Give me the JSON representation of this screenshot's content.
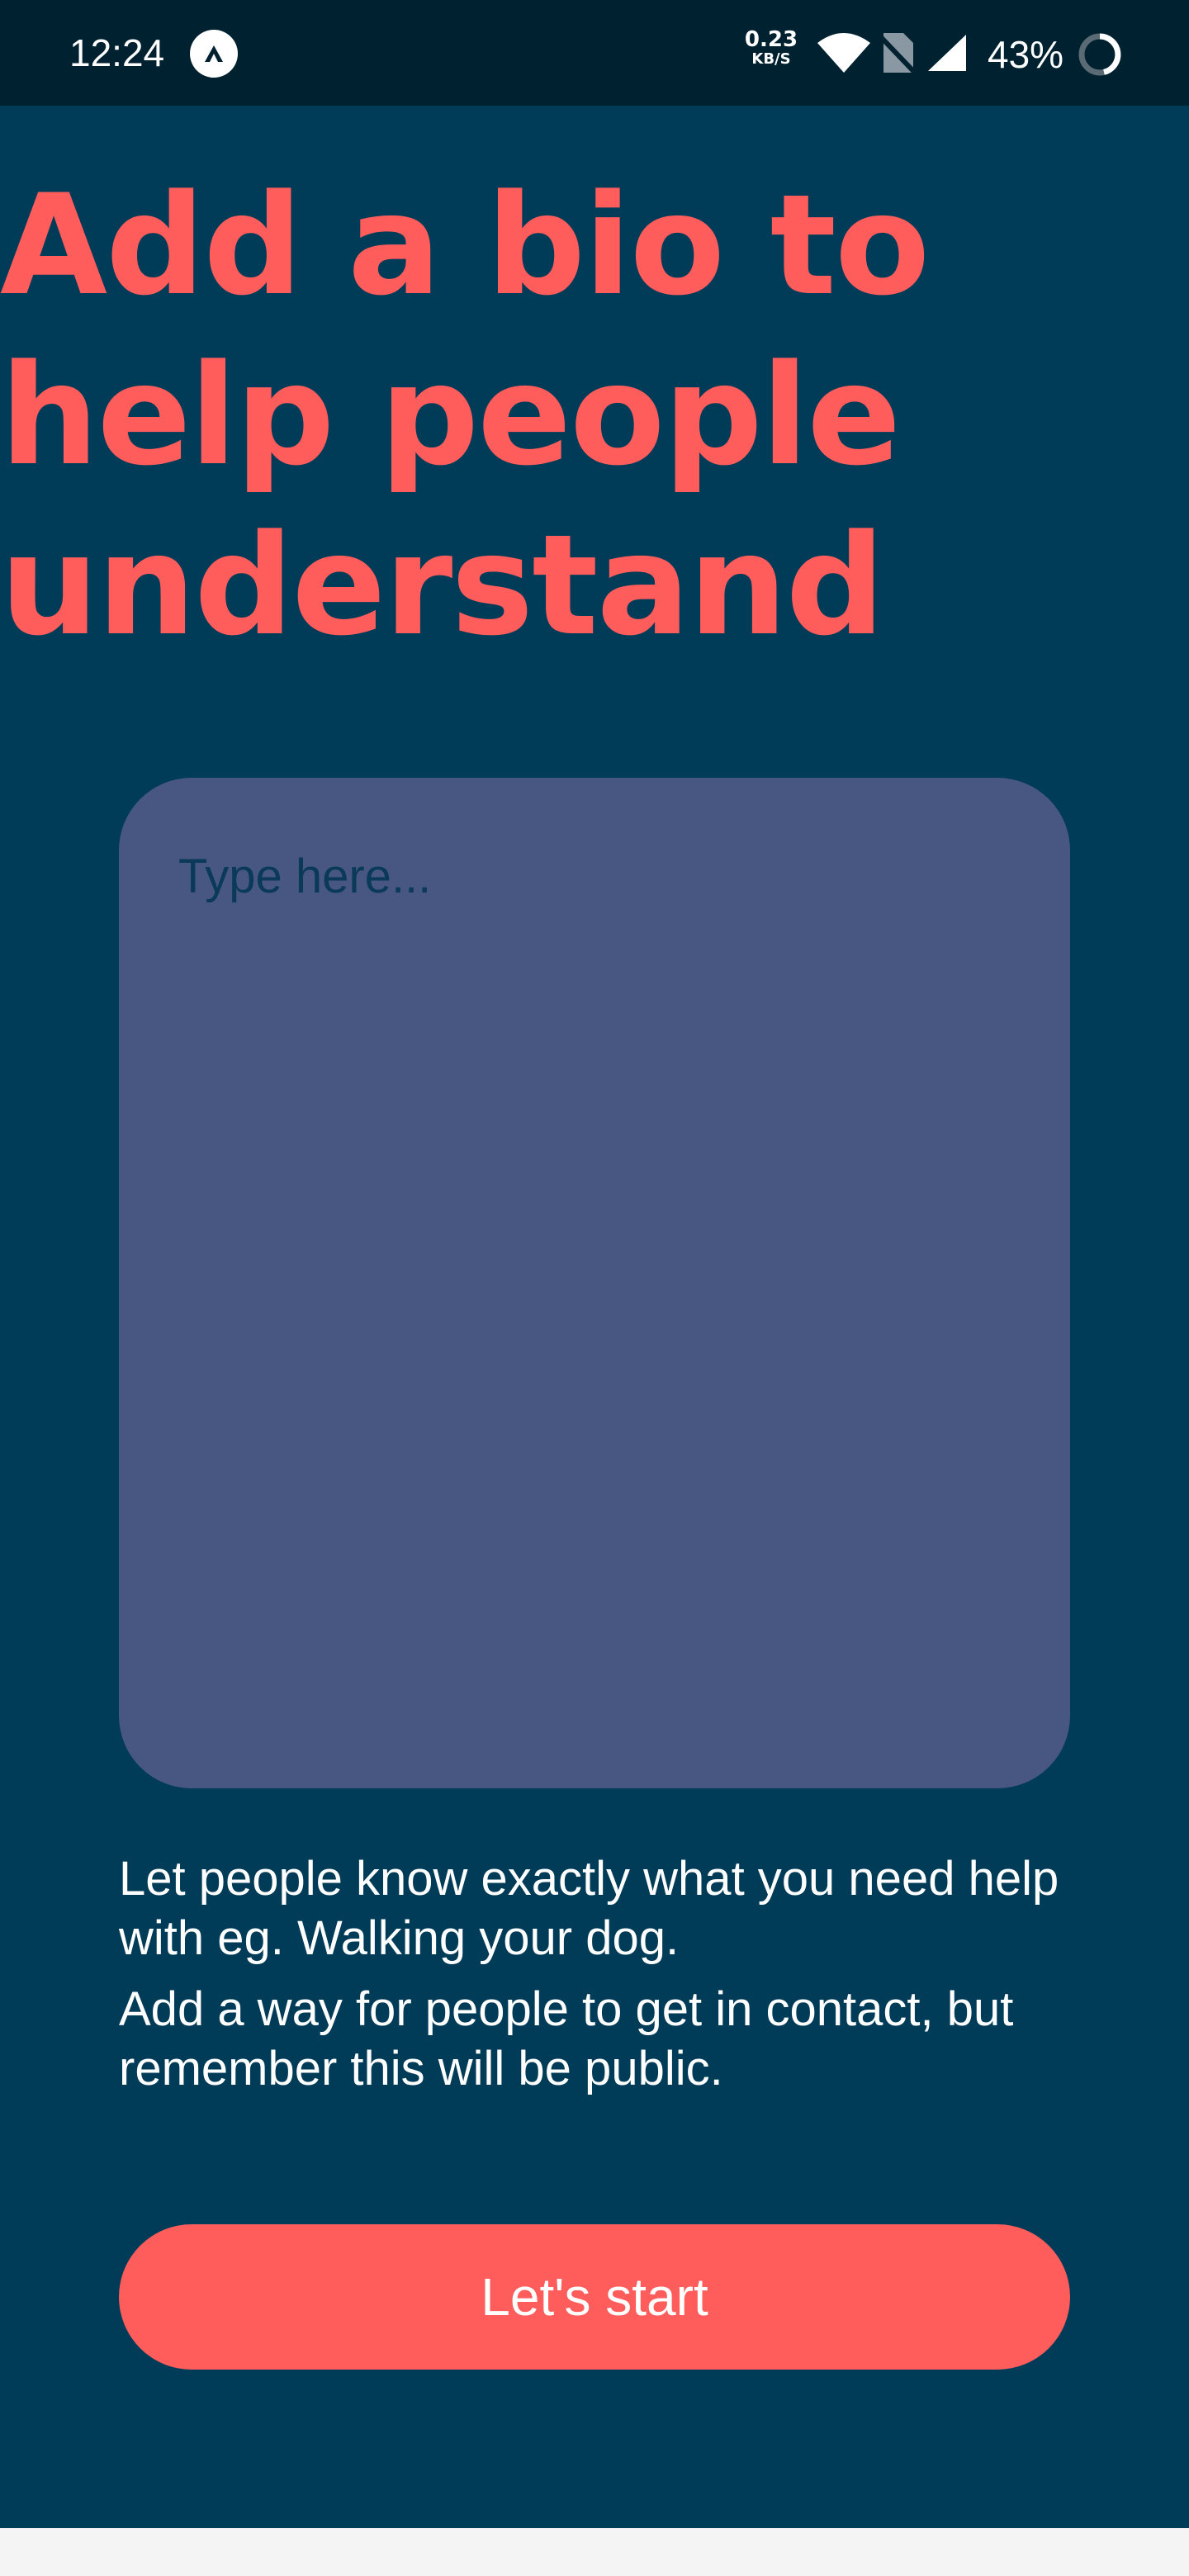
{
  "status_bar": {
    "time": "12:24",
    "app_icon": "expo-caret-icon",
    "net_speed_value": "0.23",
    "net_speed_unit": "KB/S",
    "battery_percent": "43%",
    "icons": [
      "wifi-icon",
      "no-sim-icon",
      "cell-signal-icon",
      "battery-ring-icon"
    ]
  },
  "main": {
    "headline": "Add a bio to help people understand",
    "bio_placeholder": "Type here...",
    "bio_value": "",
    "help_text_1": "Let people know exactly what you need help with eg. Walking your dog.",
    "help_text_2": "Add a way for people to get in contact, but remember this will be public.",
    "start_button_label": "Let's start"
  },
  "colors": {
    "background": "#003b57",
    "accent": "#ff5c5c",
    "input_background": "#475781",
    "status_bar": "#00212f"
  }
}
